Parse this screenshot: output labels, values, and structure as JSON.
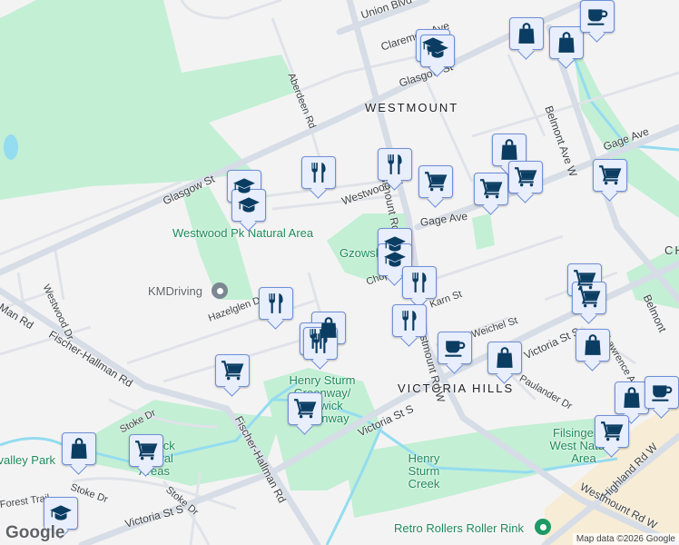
{
  "map": {
    "neighbourhoods": [
      "WESTMOUNT",
      "VICTORIA HILLS"
    ],
    "streets": [
      "Union Blvd",
      "Claremont Ave",
      "Glasgow St",
      "Glasgow St",
      "Aberdeen Rd",
      "Westmount Rd W",
      "Belmont Ave W",
      "Gage Ave",
      "Gage Ave",
      "Westwood Dr",
      "Westwood Dr",
      "Hazelglen Dr",
      "Fischer-Hallman Rd",
      "Fischer-Hallman Rd",
      "Stoke Dr",
      "Stoke Dr",
      "Stoke Dr",
      "Victoria St S",
      "Victoria St S",
      "Victoria St S",
      "Karn St",
      "Weichel St",
      "Paulander Dr",
      "Lawrence Ave",
      "Highland Rd W",
      "Westmount Rd W",
      "Forest Trail",
      "Chopin Dr",
      "Westmount Rd W",
      "Belmont",
      "Man Rd"
    ],
    "parks": [
      "Westwood Pk Natural Area",
      "Gzowski Park",
      "Henry Sturm Greenway/ Borwick Greenway",
      "Henry Sturm Creek",
      "Filsinger Pk West Natural Area",
      "Glenvalley Park",
      "Borwick Natural Areas"
    ],
    "places": [
      "KMDriving",
      "Retro Rollers Roller Rink"
    ],
    "partial_label": "CH",
    "colors": {
      "park": "#c3efd5",
      "road": "#d6dde6",
      "water": "#94dcef",
      "marker_bg": "#e8eefc",
      "marker_icon": "#0b3d62",
      "place_pin_gray": "#7b8791",
      "place_pin_green": "#1e9a64",
      "commercial": "#f7ecd5"
    }
  },
  "markers": [
    {
      "icon": "school-icon"
    },
    {
      "icon": "restaurant-icon"
    },
    {
      "icon": "shopping-cart-icon"
    }
  ],
  "footer": {
    "logo": "Google",
    "attribution": "Map data ©2026 Google"
  }
}
